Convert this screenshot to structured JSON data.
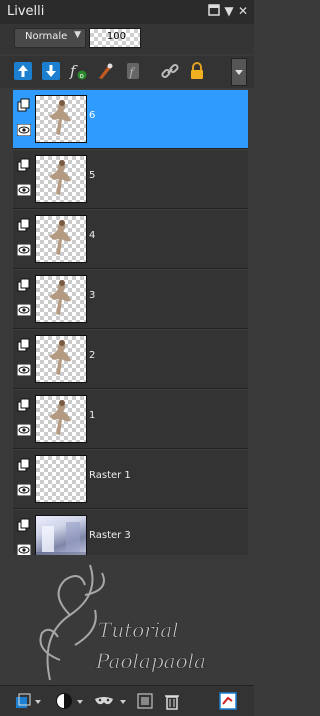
{
  "panel": {
    "title": "Livelli"
  },
  "controls": {
    "blend_mode": "Normale",
    "opacity": "100"
  },
  "layers": [
    {
      "name": "6",
      "selected": true,
      "thumb": "figure-transparent"
    },
    {
      "name": "5",
      "selected": false,
      "thumb": "figure-transparent"
    },
    {
      "name": "4",
      "selected": false,
      "thumb": "figure-transparent"
    },
    {
      "name": "3",
      "selected": false,
      "thumb": "figure-transparent"
    },
    {
      "name": "2",
      "selected": false,
      "thumb": "figure-transparent"
    },
    {
      "name": "1",
      "selected": false,
      "thumb": "figure-transparent"
    },
    {
      "name": "Raster 1",
      "selected": false,
      "thumb": "transparent"
    },
    {
      "name": "Raster 3",
      "selected": false,
      "thumb": "photo"
    }
  ],
  "watermark": {
    "line1": "Tutorial",
    "line2": "Paolapaola"
  },
  "colors": {
    "selected": "#2f9bff",
    "panel_bg": "#3a3a3a",
    "row_bg": "#333333"
  }
}
